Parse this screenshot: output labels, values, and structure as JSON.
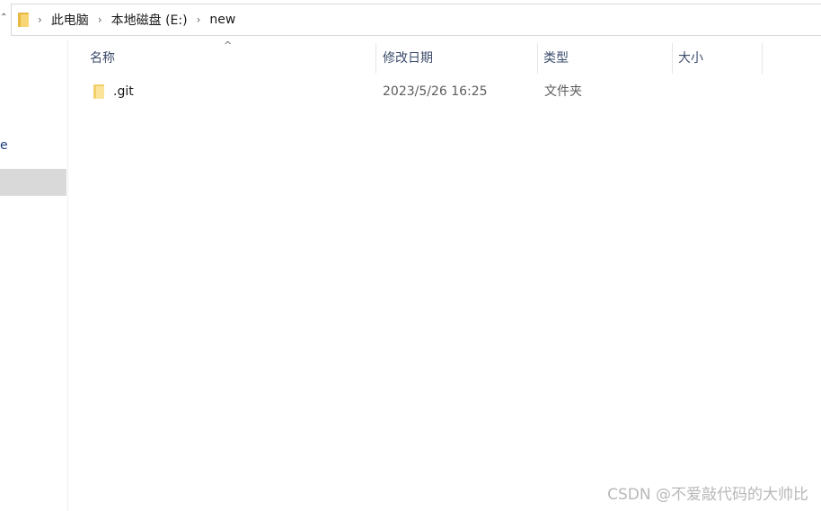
{
  "address_bar": {
    "crumbs": [
      "此电脑",
      "本地磁盘 (E:)",
      "new"
    ],
    "separator": "›"
  },
  "nav_pane": {
    "fragment_text": "e"
  },
  "columns": {
    "name": "名称",
    "modified": "修改日期",
    "type": "类型",
    "size": "大小"
  },
  "sort_indicator": "^",
  "files": [
    {
      "name": ".git",
      "modified": "2023/5/26 16:25",
      "type": "文件夹",
      "size": "",
      "icon": "folder-icon"
    }
  ],
  "watermark": "CSDN @不爱敲代码的大帅比",
  "colors": {
    "folder_back": "#e8b840",
    "folder_front": "#f8d675",
    "selection": "#d9d9d9",
    "header_text": "#3b4b6b"
  }
}
